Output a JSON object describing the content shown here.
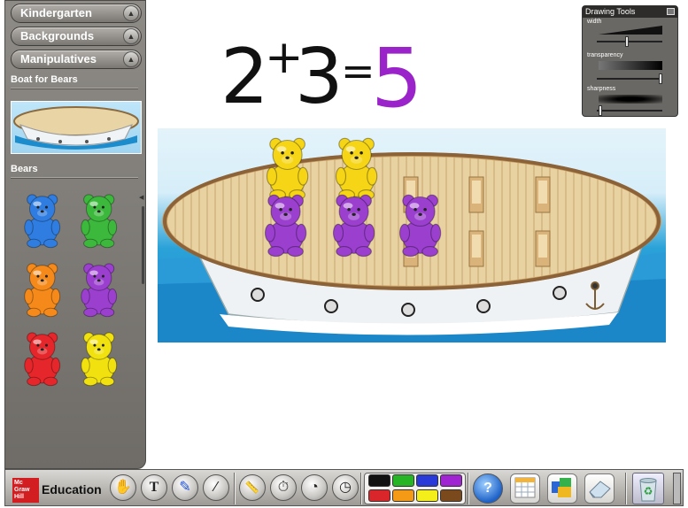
{
  "sidebar": {
    "categories": [
      {
        "label": "Kindergarten"
      },
      {
        "label": "Backgrounds"
      },
      {
        "label": "Manipulatives"
      }
    ],
    "section_boat": "Boat for Bears",
    "section_bears": "Bears",
    "bears": [
      {
        "color": "#2f7de0"
      },
      {
        "color": "#3cb83c"
      },
      {
        "color": "#f58a1a"
      },
      {
        "color": "#9b3fcf"
      },
      {
        "color": "#e5262a"
      },
      {
        "color": "#f1e10f"
      }
    ]
  },
  "equation": {
    "left": "2",
    "op1": "+",
    "right": "3",
    "op2": "=",
    "result": "5",
    "result_color": "#9a23c9",
    "ink_color": "#111111"
  },
  "drawing_tools": {
    "title": "Drawing Tools",
    "width_label": "width",
    "transparency_label": "transparency",
    "sharpness_label": "sharpness",
    "width_value": 0.45,
    "transparency_value": 0.97,
    "sharpness_value": 0.03
  },
  "stage": {
    "boat": "boat-for-bears",
    "bears_on_boat": [
      {
        "color": "#f5d516"
      },
      {
        "color": "#f5d516"
      },
      {
        "color": "#9b3fcf"
      },
      {
        "color": "#9b3fcf"
      },
      {
        "color": "#9b3fcf"
      }
    ]
  },
  "toolbar": {
    "logo_lines": [
      "Mc",
      "Graw",
      "Hill"
    ],
    "brand": "Education",
    "tools": [
      "hand-icon",
      "text-icon",
      "pen-icon",
      "wand-icon",
      "ruler-icon",
      "timer-icon",
      "protractor-icon",
      "clock-icon"
    ],
    "tool_glyphs": [
      "✋",
      "T",
      "✎",
      "⁄",
      "📏",
      "⏱",
      "◔",
      "◷"
    ],
    "colors": [
      "#111111",
      "#25b525",
      "#2a3ad8",
      "#a124d2",
      "#d8262a",
      "#f49a16",
      "#f4ee1a",
      "#7a4a1c"
    ],
    "help": "?"
  }
}
